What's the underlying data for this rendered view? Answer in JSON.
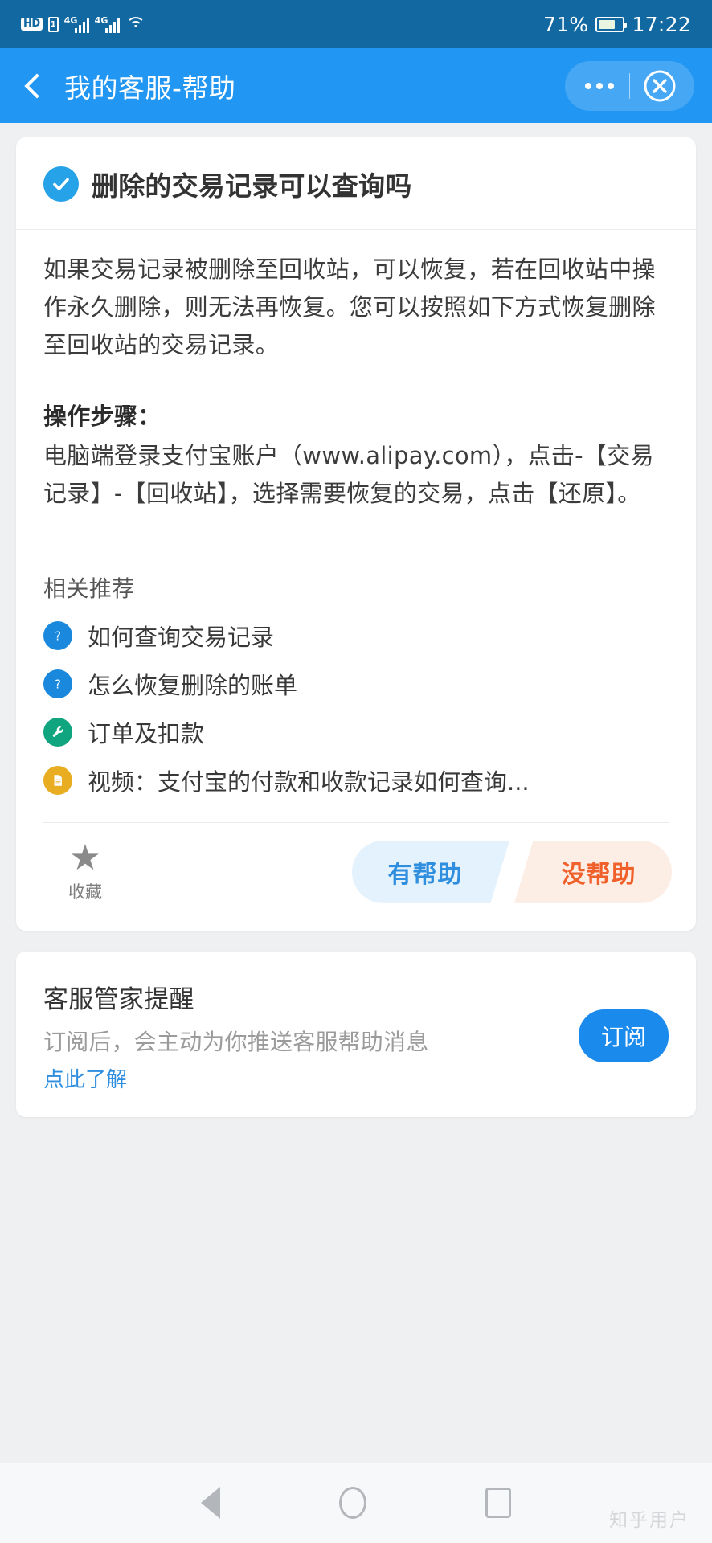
{
  "status_bar": {
    "hd_label": "HD",
    "sim_label": "1",
    "network_1": "4G",
    "network_2": "4G",
    "battery_percent": "71%",
    "time": "17:22",
    "icons": [
      "hd-icon",
      "sim-card-icon",
      "signal-bars-icon",
      "wifi-icon",
      "battery-icon"
    ]
  },
  "header": {
    "title": "我的客服-帮助",
    "back_icon": "chevron-left-icon",
    "more_icon": "more-horizontal-icon",
    "close_icon": "close-circle-icon",
    "background_color": "#2196f3"
  },
  "article": {
    "title": "删除的交易记录可以查询吗",
    "title_icon": "check-circle-icon",
    "paragraph": "如果交易记录被删除至回收站，可以恢复，若在回收站中操作永久删除，则无法再恢复。您可以按照如下方式恢复删除至回收站的交易记录。",
    "steps_heading": "操作步骤：",
    "steps_body": "电脑端登录支付宝账户（www.alipay.com），点击-【交易记录】-【回收站】，选择需要恢复的交易，点击【还原】。"
  },
  "related": {
    "heading": "相关推荐",
    "items": [
      {
        "label": "如何查询交易记录",
        "icon": "question-circle-icon",
        "icon_color": "#1a88dd"
      },
      {
        "label": "怎么恢复删除的账单",
        "icon": "question-circle-icon",
        "icon_color": "#1a88dd"
      },
      {
        "label": "订单及扣款",
        "icon": "wrench-circle-icon",
        "icon_color": "#11a57f"
      },
      {
        "label": "视频：支付宝的付款和收款记录如何查询...",
        "icon": "document-circle-icon",
        "icon_color": "#e8ad21"
      }
    ]
  },
  "feedback": {
    "favorite_label": "收藏",
    "favorite_icon": "star-icon",
    "helpful_label": "有帮助",
    "not_helpful_label": "没帮助",
    "helpful_color": "#2f8ede",
    "not_helpful_color": "#f0602a"
  },
  "subscribe": {
    "title": "客服管家提醒",
    "description": "订阅后，会主动为你推送客服帮助消息",
    "link": "点此了解",
    "button_label": "订阅",
    "button_color": "#1a8aed"
  },
  "nav_bar": {
    "back_icon": "triangle-back-icon",
    "home_icon": "circle-home-icon",
    "recent_icon": "square-recent-icon"
  },
  "watermark": {
    "text": "知乎用户"
  }
}
